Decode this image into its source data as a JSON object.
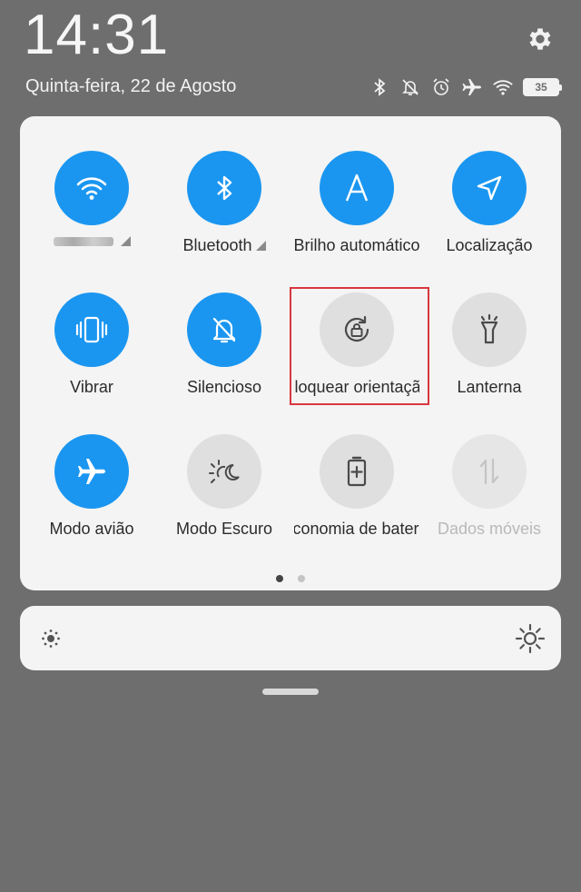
{
  "status_bar": {
    "time": "14:31",
    "date": "Quinta-feira, 22 de Agosto",
    "battery_level": "35",
    "icons": [
      "bluetooth-icon",
      "mute-icon",
      "alarm-icon",
      "airplane-icon",
      "wifi-icon",
      "battery-icon"
    ]
  },
  "quick_settings": {
    "tiles": [
      {
        "id": "wifi",
        "label": "",
        "state": "on",
        "icon": "wifi-icon"
      },
      {
        "id": "bluetooth",
        "label": "Bluetooth",
        "state": "on",
        "icon": "bluetooth-icon"
      },
      {
        "id": "auto-brightness",
        "label": "Brilho automático",
        "state": "on",
        "icon": "letter-a-icon"
      },
      {
        "id": "location",
        "label": "Localização",
        "state": "on",
        "icon": "location-arrow-icon"
      },
      {
        "id": "vibrate",
        "label": "Vibrar",
        "state": "on",
        "icon": "vibrate-icon"
      },
      {
        "id": "silent",
        "label": "Silencioso",
        "state": "on",
        "icon": "bell-off-icon"
      },
      {
        "id": "rotation-lock",
        "label": "Bloquear orientação",
        "state": "off",
        "icon": "rotation-lock-icon"
      },
      {
        "id": "flashlight",
        "label": "Lanterna",
        "state": "off",
        "icon": "flashlight-icon"
      },
      {
        "id": "airplane",
        "label": "Modo avião",
        "state": "on",
        "icon": "airplane-icon"
      },
      {
        "id": "dark-mode",
        "label": "Modo Escuro",
        "state": "off",
        "icon": "dark-mode-icon"
      },
      {
        "id": "battery-saver",
        "label": "Economia de bateria",
        "state": "off",
        "icon": "battery-saver-icon"
      },
      {
        "id": "mobile-data",
        "label": "Dados móveis",
        "state": "disabled",
        "icon": "data-arrows-icon"
      }
    ],
    "page_indicator": {
      "current": 1,
      "total": 2
    }
  },
  "brightness": {
    "low_icon": "brightness-low-icon",
    "high_icon": "brightness-high-icon"
  },
  "colors": {
    "accent": "#1a96f0",
    "background": "#6e6e6e",
    "panel": "#f4f4f4",
    "highlight": "#d9363e"
  }
}
